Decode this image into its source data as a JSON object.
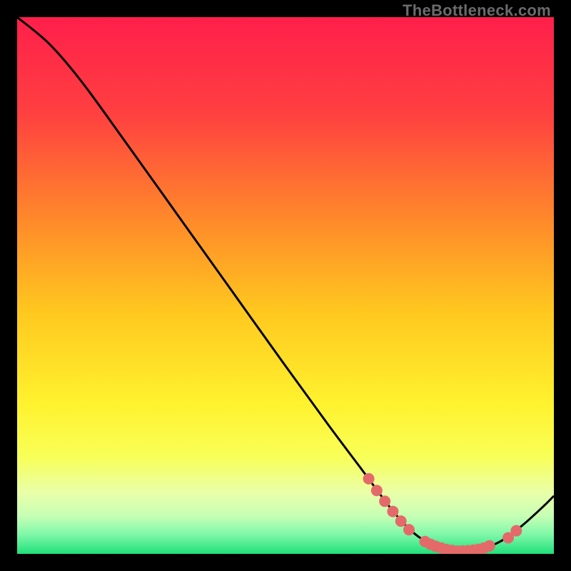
{
  "watermark": "TheBottleneck.com",
  "chart_data": {
    "type": "line",
    "title": "",
    "xlabel": "",
    "ylabel": "",
    "xlim": [
      0,
      100
    ],
    "ylim": [
      0,
      100
    ],
    "curve": [
      {
        "x": 0,
        "y": 100
      },
      {
        "x": 6,
        "y": 95
      },
      {
        "x": 12,
        "y": 88
      },
      {
        "x": 20,
        "y": 77
      },
      {
        "x": 30,
        "y": 63
      },
      {
        "x": 40,
        "y": 49
      },
      {
        "x": 50,
        "y": 35
      },
      {
        "x": 58,
        "y": 24
      },
      {
        "x": 64,
        "y": 16
      },
      {
        "x": 70,
        "y": 8
      },
      {
        "x": 74,
        "y": 3.8
      },
      {
        "x": 78,
        "y": 1.4
      },
      {
        "x": 82,
        "y": 0.5
      },
      {
        "x": 86,
        "y": 0.8
      },
      {
        "x": 90,
        "y": 2.3
      },
      {
        "x": 94,
        "y": 5.2
      },
      {
        "x": 98,
        "y": 8.8
      },
      {
        "x": 100,
        "y": 10.8
      }
    ],
    "markers": [
      {
        "x": 65.5,
        "y": 14.0
      },
      {
        "x": 67.0,
        "y": 11.8
      },
      {
        "x": 68.5,
        "y": 9.8
      },
      {
        "x": 70.0,
        "y": 7.9
      },
      {
        "x": 71.5,
        "y": 6.1
      },
      {
        "x": 73.0,
        "y": 4.5
      },
      {
        "x": 76.0,
        "y": 2.3
      },
      {
        "x": 77.0,
        "y": 1.8
      },
      {
        "x": 78.0,
        "y": 1.4
      },
      {
        "x": 79.0,
        "y": 1.1
      },
      {
        "x": 80.0,
        "y": 0.8
      },
      {
        "x": 81.0,
        "y": 0.65
      },
      {
        "x": 82.0,
        "y": 0.5
      },
      {
        "x": 83.0,
        "y": 0.55
      },
      {
        "x": 84.0,
        "y": 0.6
      },
      {
        "x": 85.0,
        "y": 0.7
      },
      {
        "x": 86.0,
        "y": 0.85
      },
      {
        "x": 87.0,
        "y": 1.1
      },
      {
        "x": 88.0,
        "y": 1.5
      },
      {
        "x": 91.5,
        "y": 3.0
      },
      {
        "x": 93.0,
        "y": 4.3
      }
    ],
    "background_gradient": [
      {
        "offset": 0.0,
        "color": "#ff1f4b"
      },
      {
        "offset": 0.18,
        "color": "#ff4040"
      },
      {
        "offset": 0.38,
        "color": "#ff8a2a"
      },
      {
        "offset": 0.55,
        "color": "#ffc81f"
      },
      {
        "offset": 0.72,
        "color": "#fff22e"
      },
      {
        "offset": 0.82,
        "color": "#f8ff58"
      },
      {
        "offset": 0.885,
        "color": "#eaffa8"
      },
      {
        "offset": 0.93,
        "color": "#c6ffb6"
      },
      {
        "offset": 0.965,
        "color": "#7cf7a7"
      },
      {
        "offset": 1.0,
        "color": "#20e07a"
      }
    ],
    "curve_color": "#000000",
    "marker_color": "#e46a6a",
    "marker_radius": 8
  }
}
